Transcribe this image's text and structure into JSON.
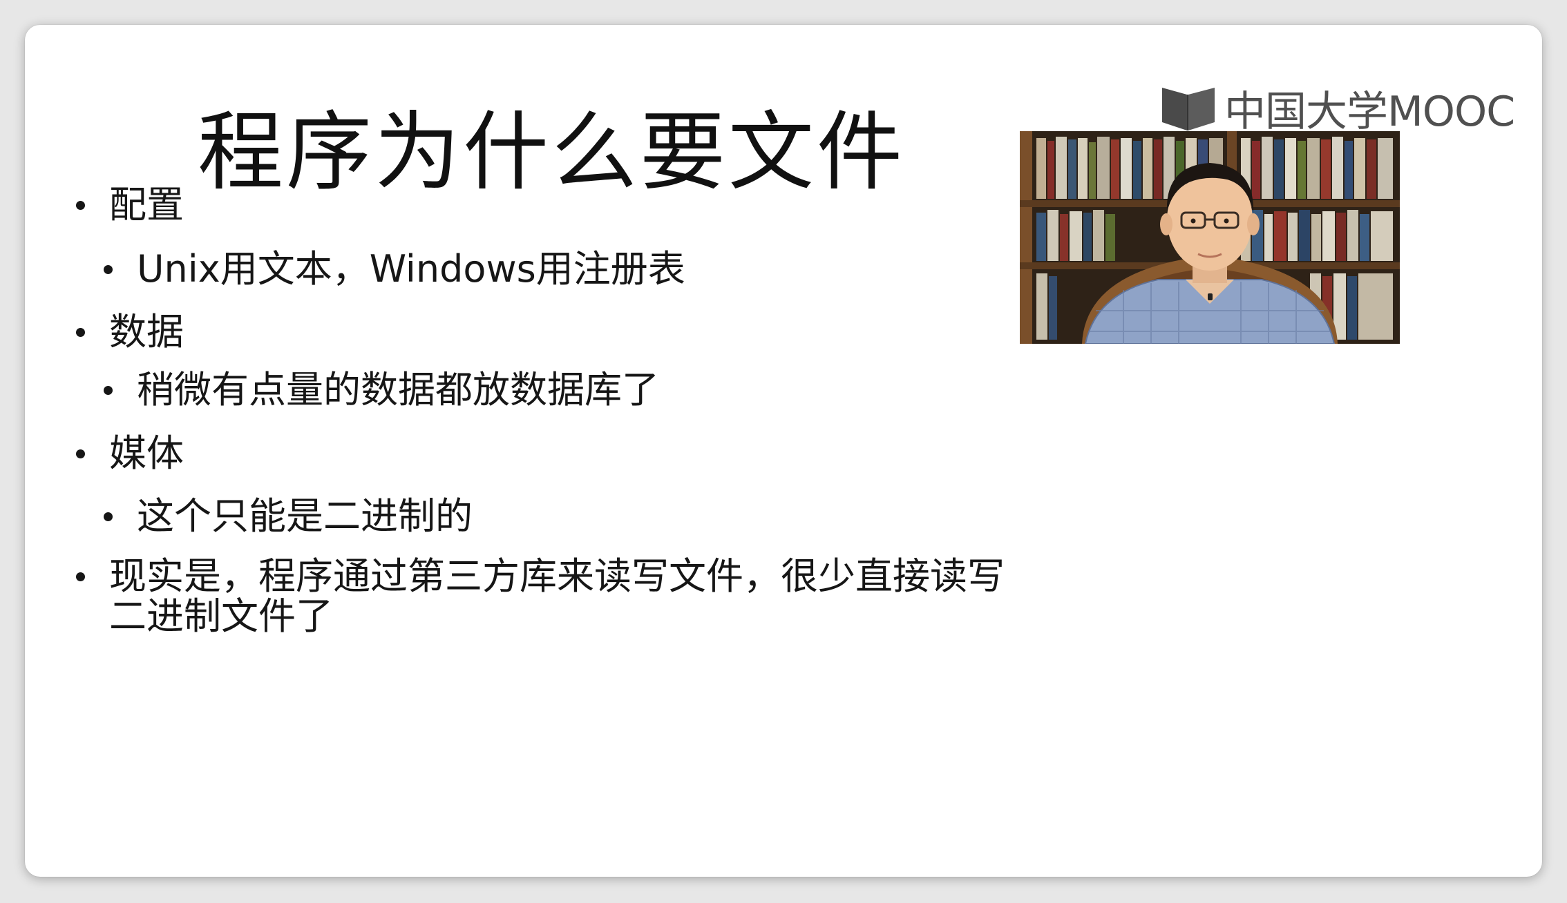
{
  "slide": {
    "title": "程序为什么要文件",
    "logo": {
      "icon": "book-icon",
      "text": "中国大学MOOC"
    },
    "video": {
      "description_icon": "presenter-video"
    },
    "bullets": [
      {
        "level": 1,
        "text": "配置"
      },
      {
        "level": 2,
        "text": "Unix用文本，Windows用注册表"
      },
      {
        "level": 1,
        "text": "数据"
      },
      {
        "level": 2,
        "text": "稍微有点量的数据都放数据库了"
      },
      {
        "level": 1,
        "text": "媒体"
      },
      {
        "level": 2,
        "text": "这个只能是二进制的"
      },
      {
        "level": 1,
        "text": "现实是，程序通过第三方库来读写文件，很少直接读写二进制文件了"
      }
    ]
  },
  "colors": {
    "background": "#e7e7e7",
    "slide": "#ffffff",
    "text": "#161616",
    "logo": "#555555"
  }
}
